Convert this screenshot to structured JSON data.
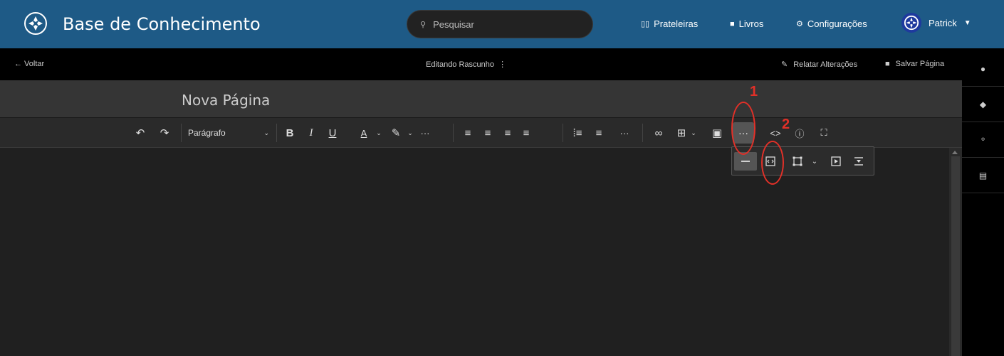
{
  "header": {
    "app_title": "Base de Conhecimento",
    "search_placeholder": "Pesquisar",
    "nav": [
      {
        "label": "Prateleiras",
        "icon": "shelves-icon"
      },
      {
        "label": "Livros",
        "icon": "book-icon"
      },
      {
        "label": "Configurações",
        "icon": "gear-icon"
      }
    ],
    "user_name": "Patrick"
  },
  "edit_bar": {
    "back_label": "← Voltar",
    "status": "Editando Rascunho",
    "changes_label": "Relatar Alterações",
    "save_label": "Salvar Página"
  },
  "page": {
    "title": "Nova Página"
  },
  "toolbar": {
    "format_select": "Parágrafo",
    "more_label": "···"
  },
  "annotations": {
    "label_1": "1",
    "label_2": "2"
  },
  "colors": {
    "header_bg": "#1e5a86",
    "annotation": "#e23028"
  }
}
